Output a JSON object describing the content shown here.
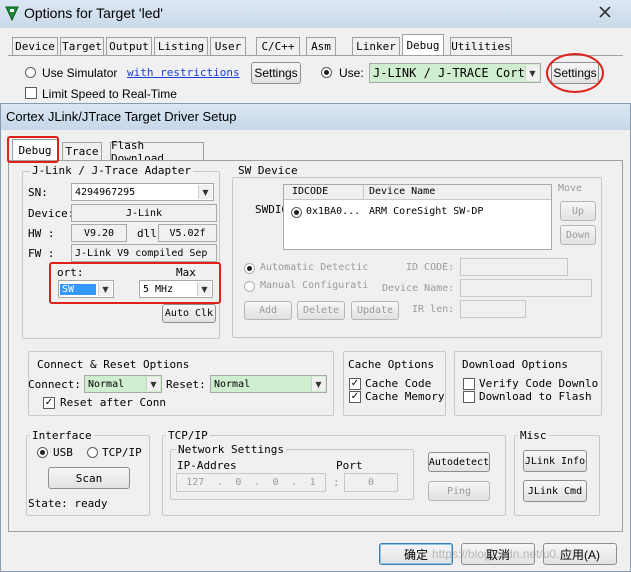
{
  "outer": {
    "title": "Options for Target 'led'",
    "tabs": [
      "Device",
      "Target",
      "Output",
      "Listing",
      "User",
      "C/C++",
      "Asm",
      "Linker",
      "Debug",
      "Utilities"
    ],
    "use_simulator": "Use Simulator",
    "with_restrictions": "with restrictions",
    "limit_speed": "Limit Speed to Real-Time",
    "settings_left": "Settings",
    "use_label": "Use:",
    "driver": "J-LINK / J-TRACE Cortex",
    "settings_right": "Settings"
  },
  "dialog": {
    "title": "Cortex JLink/JTrace Target Driver Setup",
    "tabs": [
      "Debug",
      "Trace",
      "Flash Download"
    ]
  },
  "adapter": {
    "group_label": "J-Link / J-Trace Adapter",
    "sn_label": "SN:",
    "sn_value": "4294967295",
    "device_label": "Device:",
    "device_value": "J-Link",
    "hw_label": "HW :",
    "hw_value": "V9.20",
    "dll_label": "dll",
    "dll_value": "V5.02f",
    "fw_label": "FW :",
    "fw_value": "J-Link V9 compiled Sep",
    "port_label": "ort:",
    "max_label": "Max",
    "port_value": "SW",
    "speed_value": "5 MHz",
    "auto_clk": "Auto Clk"
  },
  "swdevice": {
    "group_label": "SW Device",
    "swdio_label": "SWDIO",
    "col_idcode": "IDCODE",
    "col_device": "Device Name",
    "row_id": "0x1BA0...",
    "row_name": "ARM CoreSight SW-DP",
    "move": "Move",
    "up": "Up",
    "down": "Down",
    "auto_detect": "Automatic Detectic",
    "manual_config": "Manual Configurati",
    "id_code_label": "ID CODE:",
    "device_name_label": "Device Name:",
    "ir_len_label": "IR len:",
    "add": "Add",
    "delete": "Delete",
    "update": "Update"
  },
  "connect": {
    "group_label": "Connect & Reset Options",
    "connect_label": "Connect:",
    "connect_value": "Normal",
    "reset_label": "Reset:",
    "reset_value": "Normal",
    "reset_after": "Reset after Conn"
  },
  "cache": {
    "group_label": "Cache Options",
    "cache_code": "Cache Code",
    "cache_memory": "Cache Memory"
  },
  "download": {
    "group_label": "Download Options",
    "verify": "Verify Code Downlo",
    "download_flash": "Download to Flash"
  },
  "interface": {
    "group_label": "Interface",
    "usb": "USB",
    "tcpip": "TCP/IP",
    "scan": "Scan",
    "state": "State: ready"
  },
  "tcpip": {
    "group_label": "TCP/IP",
    "network_settings": "Network Settings",
    "ip_label": "IP-Addres",
    "port_label": "Port",
    "ip": [
      "127",
      "0",
      "0",
      "1"
    ],
    "port_value": "0",
    "autodetect": "Autodetect",
    "ping": "Ping"
  },
  "misc": {
    "group_label": "Misc",
    "jlink_info": "JLink Info",
    "jlink_cmd": "JLink Cmd"
  },
  "footer": {
    "ok": "确定",
    "cancel": "取消",
    "apply": "应用(A)",
    "watermark": "https://blog.csdn.net/u0..."
  },
  "colors": {
    "highlight_red": "#e0201a",
    "green_field": "#cfeecf",
    "selection_blue": "#3399ff"
  }
}
